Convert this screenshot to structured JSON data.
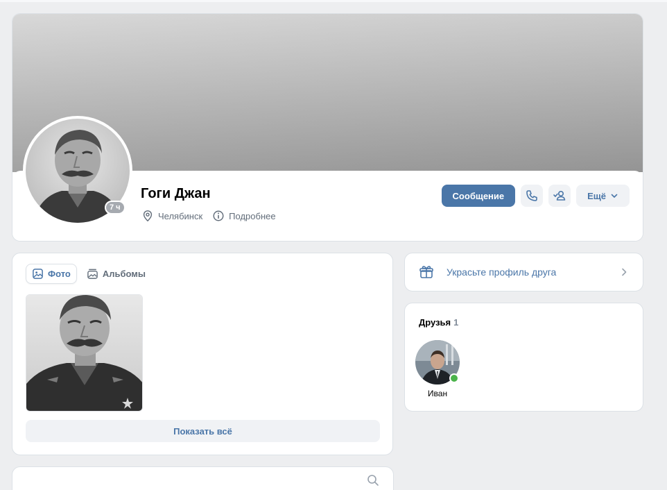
{
  "profile": {
    "name": "Гоги Джан",
    "last_seen": "7 ч",
    "city": "Челябинск",
    "details_link": "Подробнее"
  },
  "actions": {
    "message": "Сообщение",
    "more": "Ещё"
  },
  "photos": {
    "tabs": [
      {
        "label": "Фото",
        "icon": "image-icon",
        "active": true
      },
      {
        "label": "Альбомы",
        "icon": "albums-icon",
        "active": false
      }
    ],
    "show_all": "Показать всё"
  },
  "decorate": {
    "label": "Украсьте профиль друга",
    "icon": "gift-icon"
  },
  "friends": {
    "title": "Друзья",
    "count": "1",
    "items": [
      {
        "name": "Иван",
        "online": true
      }
    ]
  },
  "colors": {
    "accent": "#4a76a8",
    "background": "#edeef0",
    "online": "#4bb34b"
  }
}
